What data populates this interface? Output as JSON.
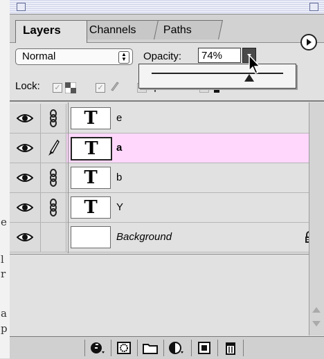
{
  "doc_strip": {
    "letters": [
      "e",
      "l",
      "r",
      "a",
      "p"
    ]
  },
  "tabs": [
    {
      "label": "Layers",
      "active": true
    },
    {
      "label": "Channels",
      "active": false
    },
    {
      "label": "Paths",
      "active": false
    }
  ],
  "blend_mode": {
    "value": "Normal"
  },
  "opacity": {
    "label": "Opacity:",
    "value": "74%",
    "fraction": 0.74
  },
  "lock": {
    "label": "Lock:"
  },
  "layers": [
    {
      "thumb": "T",
      "name": "e",
      "selected": false,
      "link": "chain"
    },
    {
      "thumb": "T",
      "name": "a",
      "selected": true,
      "link": "brush"
    },
    {
      "thumb": "T",
      "name": "b",
      "selected": false,
      "link": "chain"
    },
    {
      "thumb": "T",
      "name": "Y",
      "selected": false,
      "link": "chain"
    },
    {
      "thumb": "",
      "name": "Background",
      "selected": false,
      "link": "none",
      "locked": true
    }
  ],
  "colors": {
    "selected_row": "#ffd7fd",
    "panel_bg": "#e1e1e1"
  },
  "icons": [
    "panel-menu-icon",
    "eye-icon",
    "chain-icon",
    "brush-icon",
    "lock-icon",
    "layer-style-icon",
    "mask-icon",
    "folder-icon",
    "adjustment-icon",
    "new-layer-icon",
    "trash-icon"
  ]
}
